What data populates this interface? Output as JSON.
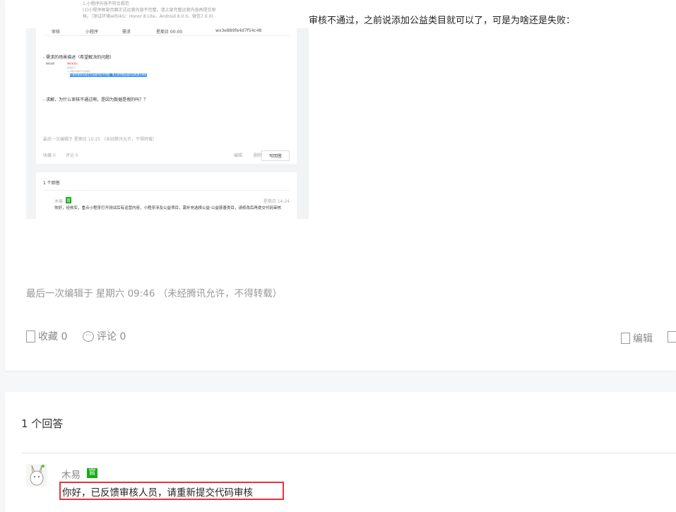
{
  "question": {
    "title_tail": "审核不通过，之前说添加公益类目就可以了，可是为啥还是失败：",
    "last_edit": "最后一次编辑于  星期六 09:46  （未经腾讯允许，不得转载）",
    "favorite": "收藏 0",
    "comment": "评论 0",
    "edit": "编辑"
  },
  "screenshot": {
    "top_lines": [
      "1.小程序内容不符合规范",
      "(1)小程序框架页面正式运营内容不完整。请上架完整运营内容再提交审",
      "核。（测试环境wifi/4G：Honor 8 Lite，Android 8.0.0，微信7.0.0)"
    ],
    "row": [
      "审核",
      "小程序",
      "需求",
      "星期日 00:00",
      "wx3e889fe4d7f54c48"
    ],
    "desc_heading": "- 需求的场景描述（希望解决的问题）",
    "detail_label": "审核说明",
    "detail_red": "审核未通过",
    "detail_lines": [
      "原因如下：",
      "1.小程序内容不符合规范",
      "小程序框架页面正式运营内容不完整，请上架完整运营内容再提交审核"
    ],
    "ask": "- 求解，为什么审核不通过啊，是因为数据是假的吗？？",
    "last_edit": "最后一次编辑于  星期日 10:25  （未经腾讯允许，不得转载）",
    "favorite": "收藏 0",
    "comment": "评论 0",
    "edit": "编辑",
    "delete": "删除",
    "reply_btn": "写回答",
    "answers": "1 个回答",
    "author": "木易",
    "badge": "官",
    "time": "星期日 14:24",
    "answer": "你好，经核实，重点小程序打开测试后有运营内容，小程序涉及公益项目，需补充选择公益-公益慈善类目，请修改后再提交代码审核"
  },
  "answers": {
    "count": "1 个回答",
    "author": "木易",
    "badge": "官",
    "reply": "你好，已反馈审核人员，请重新提交代码审核"
  }
}
